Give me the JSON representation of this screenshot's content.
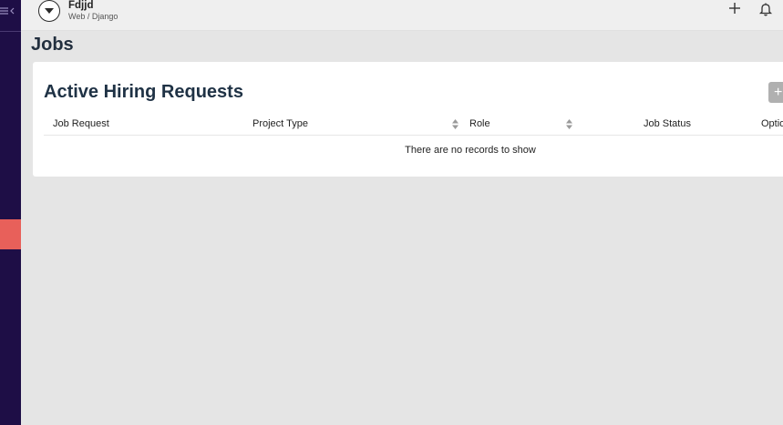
{
  "project": {
    "name": "Fdjjd",
    "subtitle": "Web / Django"
  },
  "page": {
    "title": "Jobs"
  },
  "card": {
    "title": "Active Hiring Requests",
    "add_label": "+"
  },
  "table": {
    "columns": [
      "Job Request",
      "Project Type",
      "Role",
      "Job Status",
      "Optio"
    ],
    "empty_message": "There are no records to show"
  },
  "colors": {
    "sidebar": "#1e0e46",
    "sidebar_active": "#e8605a",
    "background": "#e5e5e5",
    "card": "#ffffff"
  },
  "icons": [
    "menu-collapse-icon",
    "chevron-down-icon",
    "plus-icon",
    "bell-icon",
    "sort-icon"
  ]
}
